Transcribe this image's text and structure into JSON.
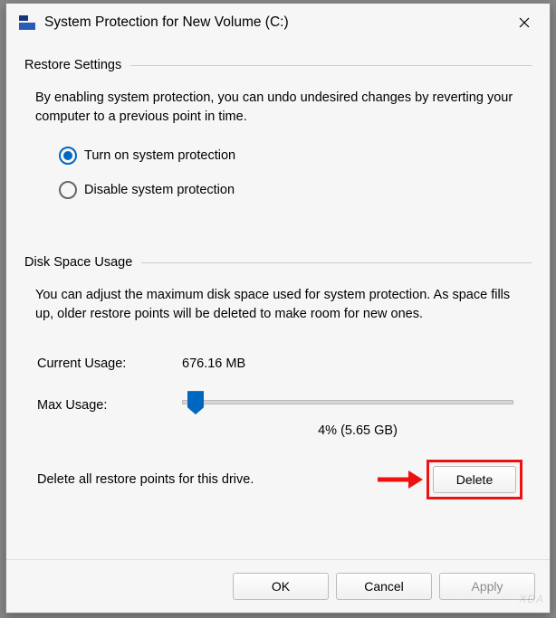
{
  "window": {
    "title": "System Protection for New Volume (C:)"
  },
  "restore": {
    "section_title": "Restore Settings",
    "description": "By enabling system protection, you can undo undesired changes by reverting your computer to a previous point in time.",
    "options": {
      "turn_on": "Turn on system protection",
      "disable": "Disable system protection"
    },
    "selected": "turn_on"
  },
  "disk": {
    "section_title": "Disk Space Usage",
    "description": "You can adjust the maximum disk space used for system protection. As space fills up, older restore points will be deleted to make room for new ones.",
    "current_usage_label": "Current Usage:",
    "current_usage_value": "676.16 MB",
    "max_usage_label": "Max Usage:",
    "slider_percent": 4,
    "slider_readout": "4% (5.65 GB)",
    "delete_text": "Delete all restore points for this drive.",
    "delete_button": "Delete"
  },
  "footer": {
    "ok": "OK",
    "cancel": "Cancel",
    "apply": "Apply"
  },
  "watermark": "XDA"
}
